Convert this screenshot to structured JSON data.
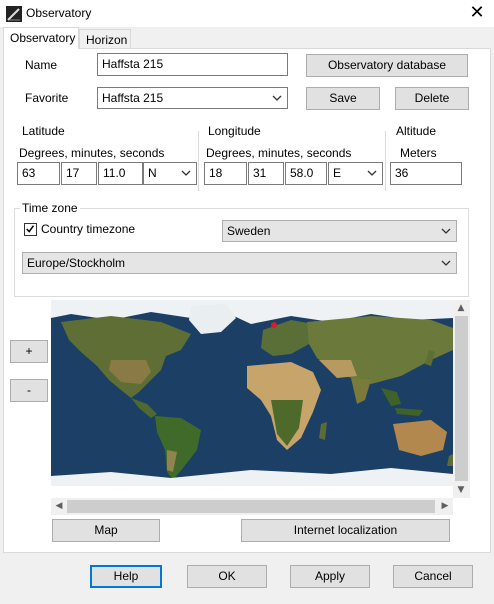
{
  "window": {
    "title": "Observatory",
    "close_glyph": "✕"
  },
  "tabs": [
    {
      "label": "Observatory",
      "active": true
    },
    {
      "label": "Horizon",
      "active": false
    }
  ],
  "name": {
    "label": "Name",
    "value": "Haffsta 215"
  },
  "favorite": {
    "label": "Favorite",
    "value": "Haffsta 215"
  },
  "buttons": {
    "observatory_database": "Observatory database",
    "save": "Save",
    "delete": "Delete",
    "zoom_in": "+",
    "zoom_out": "-",
    "map": "Map",
    "internet_localization": "Internet localization",
    "help": "Help",
    "ok": "OK",
    "apply": "Apply",
    "cancel": "Cancel"
  },
  "latitude": {
    "title": "Latitude",
    "units": "Degrees, minutes, seconds",
    "degrees": "63",
    "minutes": "17",
    "seconds": "11.0",
    "hemisphere": "N"
  },
  "longitude": {
    "title": "Longitude",
    "units": "Degrees, minutes, seconds",
    "degrees": "18",
    "minutes": "31",
    "seconds": "58.0",
    "hemisphere": "E"
  },
  "altitude": {
    "title": "Altitude",
    "units": "Meters",
    "value": "36"
  },
  "timezone": {
    "title": "Time zone",
    "country_checkbox_label": "Country timezone",
    "country_checked": true,
    "country": "Sweden",
    "zone": "Europe/Stockholm"
  },
  "map": {
    "marker_lat": 63.3,
    "marker_lon": 18.5
  },
  "colors": {
    "accent": "#0078d7",
    "ocean": "#1c3f66",
    "land": "#6b7a3a",
    "desert": "#c7a56a",
    "ice": "#eef2f5",
    "marker": "#d0202a"
  },
  "icons": {
    "app": "observatory-icon",
    "close": "close-icon",
    "dropdown": "chevron-down-icon",
    "check": "checkmark-icon",
    "scroll_up": "scroll-up-arrow",
    "scroll_down": "scroll-down-arrow",
    "scroll_left": "scroll-left-arrow",
    "scroll_right": "scroll-right-arrow"
  }
}
